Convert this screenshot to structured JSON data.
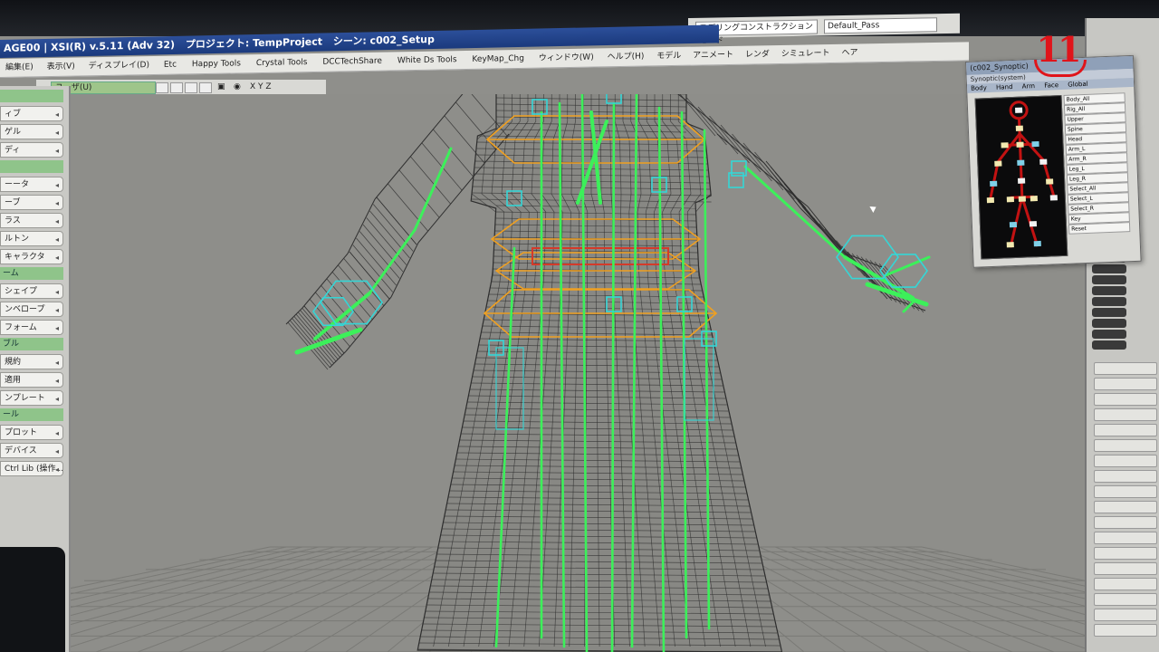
{
  "window": {
    "title_app": "AGE00 | XSI(R) v.5.11 (Adv 32)",
    "title_project": "プロジェクト: TempProject",
    "title_scene": "シーン: c002_Setup"
  },
  "top_bar": {
    "layout_select": "モデリングコンストラクションモード",
    "pass_select": "Default_Pass"
  },
  "menu": {
    "items": [
      "編集(E)",
      "表示(V)",
      "ディスプレイ(D)",
      "Etc",
      "Happy Tools",
      "Crystal Tools",
      "DCCTechShare",
      "White Ds Tools",
      "KeyMap_Chg",
      "ウィンドウ(W)",
      "ヘルプ(H)"
    ],
    "jp_items": [
      "モデル",
      "アニメート",
      "レンダ",
      "シミュレート",
      "ヘア"
    ]
  },
  "toolbar": {
    "view_select": "ユーザ(U)",
    "axes": "X Y Z"
  },
  "left_panel": {
    "items": [
      {
        "label": "",
        "kind": "header"
      },
      {
        "label": "ィブ",
        "kind": "button"
      },
      {
        "label": "ゲル",
        "kind": "button"
      },
      {
        "label": "ディ",
        "kind": "button"
      },
      {
        "label": "",
        "kind": "header"
      },
      {
        "label": "ーータ",
        "kind": "button"
      },
      {
        "label": "ーブ",
        "kind": "button"
      },
      {
        "label": "ラス",
        "kind": "button"
      },
      {
        "label": "ルトン",
        "kind": "button"
      },
      {
        "label": "キャラクタ",
        "kind": "button"
      },
      {
        "label": "ーム",
        "kind": "header"
      },
      {
        "label": "シェイプ",
        "kind": "button"
      },
      {
        "label": "ンベロープ",
        "kind": "button"
      },
      {
        "label": "フォーム",
        "kind": "button"
      },
      {
        "label": "ブル",
        "kind": "header"
      },
      {
        "label": "規約",
        "kind": "button"
      },
      {
        "label": "適用",
        "kind": "button"
      },
      {
        "label": "ンプレート",
        "kind": "button"
      },
      {
        "label": "ール",
        "kind": "header"
      },
      {
        "label": "プロット",
        "kind": "button"
      },
      {
        "label": "デバイス",
        "kind": "button"
      },
      {
        "label": "Ctrl Lib (操作...)",
        "kind": "button"
      }
    ]
  },
  "synoptic": {
    "title": "(c002_Synoptic)",
    "subtitle": "Synoptic(system)",
    "tabs": [
      "Body",
      "Hand",
      "Arm",
      "Face",
      "Global"
    ],
    "rows": [
      "Body_All",
      "Rig_All",
      "Upper",
      "Spine",
      "Head",
      "Arm_L",
      "Arm_R",
      "Leg_L",
      "Leg_R",
      "Select_All",
      "Select_L",
      "Select_R",
      "Key",
      "Reset"
    ]
  },
  "logo": {
    "text": "11"
  },
  "colors": {
    "wire": "#2f2f2f",
    "bone": "#3cf05a",
    "cage": "#f0a020",
    "null": "#35d6d6",
    "grid": "#7a7a76",
    "accent": "#e0141a"
  }
}
